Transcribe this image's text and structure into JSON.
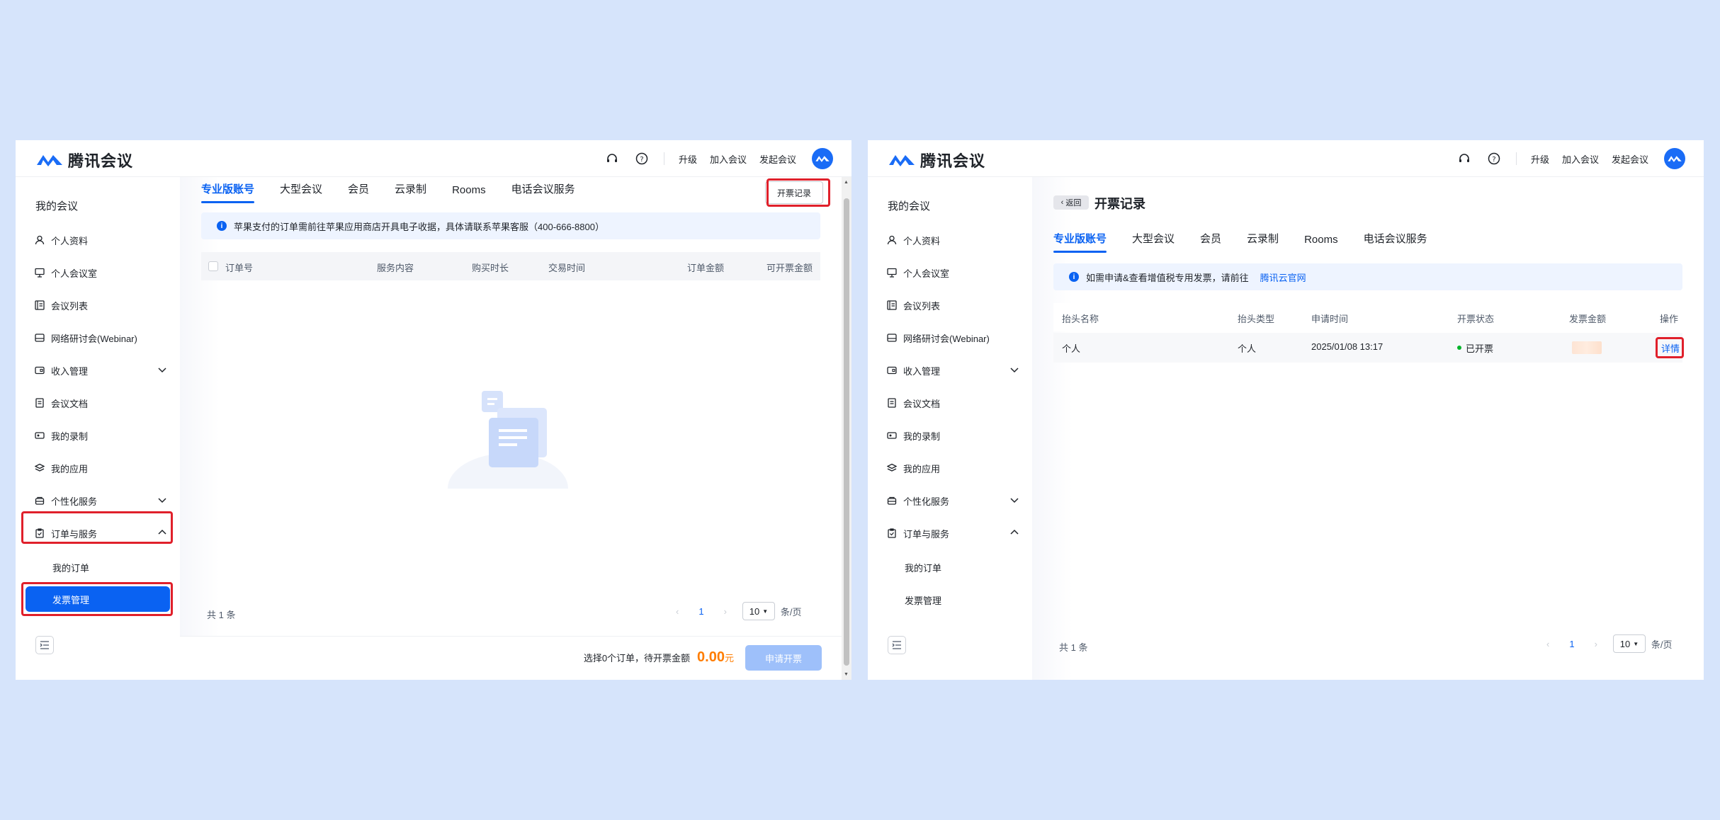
{
  "app": {
    "name": "腾讯会议"
  },
  "topbar": {
    "upgrade": "升级",
    "join": "加入会议",
    "start": "发起会议"
  },
  "sidebar": {
    "title": "我的会议",
    "items": [
      {
        "label": "个人资料",
        "icon": "user-icon"
      },
      {
        "label": "个人会议室",
        "icon": "meeting-room-icon"
      },
      {
        "label": "会议列表",
        "icon": "list-icon"
      },
      {
        "label": "网络研讨会(Webinar)",
        "icon": "webinar-icon"
      },
      {
        "label": "收入管理",
        "icon": "wallet-icon"
      },
      {
        "label": "会议文档",
        "icon": "document-icon"
      },
      {
        "label": "我的录制",
        "icon": "recording-icon"
      },
      {
        "label": "我的应用",
        "icon": "apps-icon"
      },
      {
        "label": "个性化服务",
        "icon": "personalize-icon"
      },
      {
        "label": "订单与服务",
        "icon": "clipboard-icon"
      }
    ],
    "sub_items": [
      "我的订单",
      "发票管理"
    ]
  },
  "tabs": [
    "专业版账号",
    "大型会议",
    "会员",
    "云录制",
    "Rooms",
    "电话会议服务"
  ],
  "left": {
    "invoice_records_button": "开票记录",
    "notice": "苹果支付的订单需前往苹果应用商店开具电子收据，具体请联系苹果客服（400-666-8800）",
    "columns": [
      "订单号",
      "服务内容",
      "购买时长",
      "交易时间",
      "订单金额",
      "可开票金额"
    ],
    "total": "共 1 条",
    "page": "1",
    "page_size": "10",
    "page_unit": "条/页",
    "selection_text": "选择0个订单，待开票金额",
    "pending_amount": "0.00",
    "currency": "元",
    "apply_button": "申请开票"
  },
  "right": {
    "back": "返回",
    "title": "开票记录",
    "notice": "如需申请&查看增值税专用发票，请前往",
    "notice_link": "腾讯云官网",
    "columns": [
      "抬头名称",
      "抬头类型",
      "申请时间",
      "开票状态",
      "发票金额",
      "操作"
    ],
    "rows": [
      {
        "name": "个人",
        "type": "个人",
        "time": "2025/01/08 13:17",
        "status": "已开票",
        "action": "详情"
      }
    ],
    "total": "共 1 条",
    "page": "1",
    "page_size": "10",
    "page_unit": "条/页"
  },
  "colors": {
    "accent": "#0a62f2",
    "highlight": "#e0202b",
    "amount": "#ff7d00",
    "success": "#00b42a"
  }
}
